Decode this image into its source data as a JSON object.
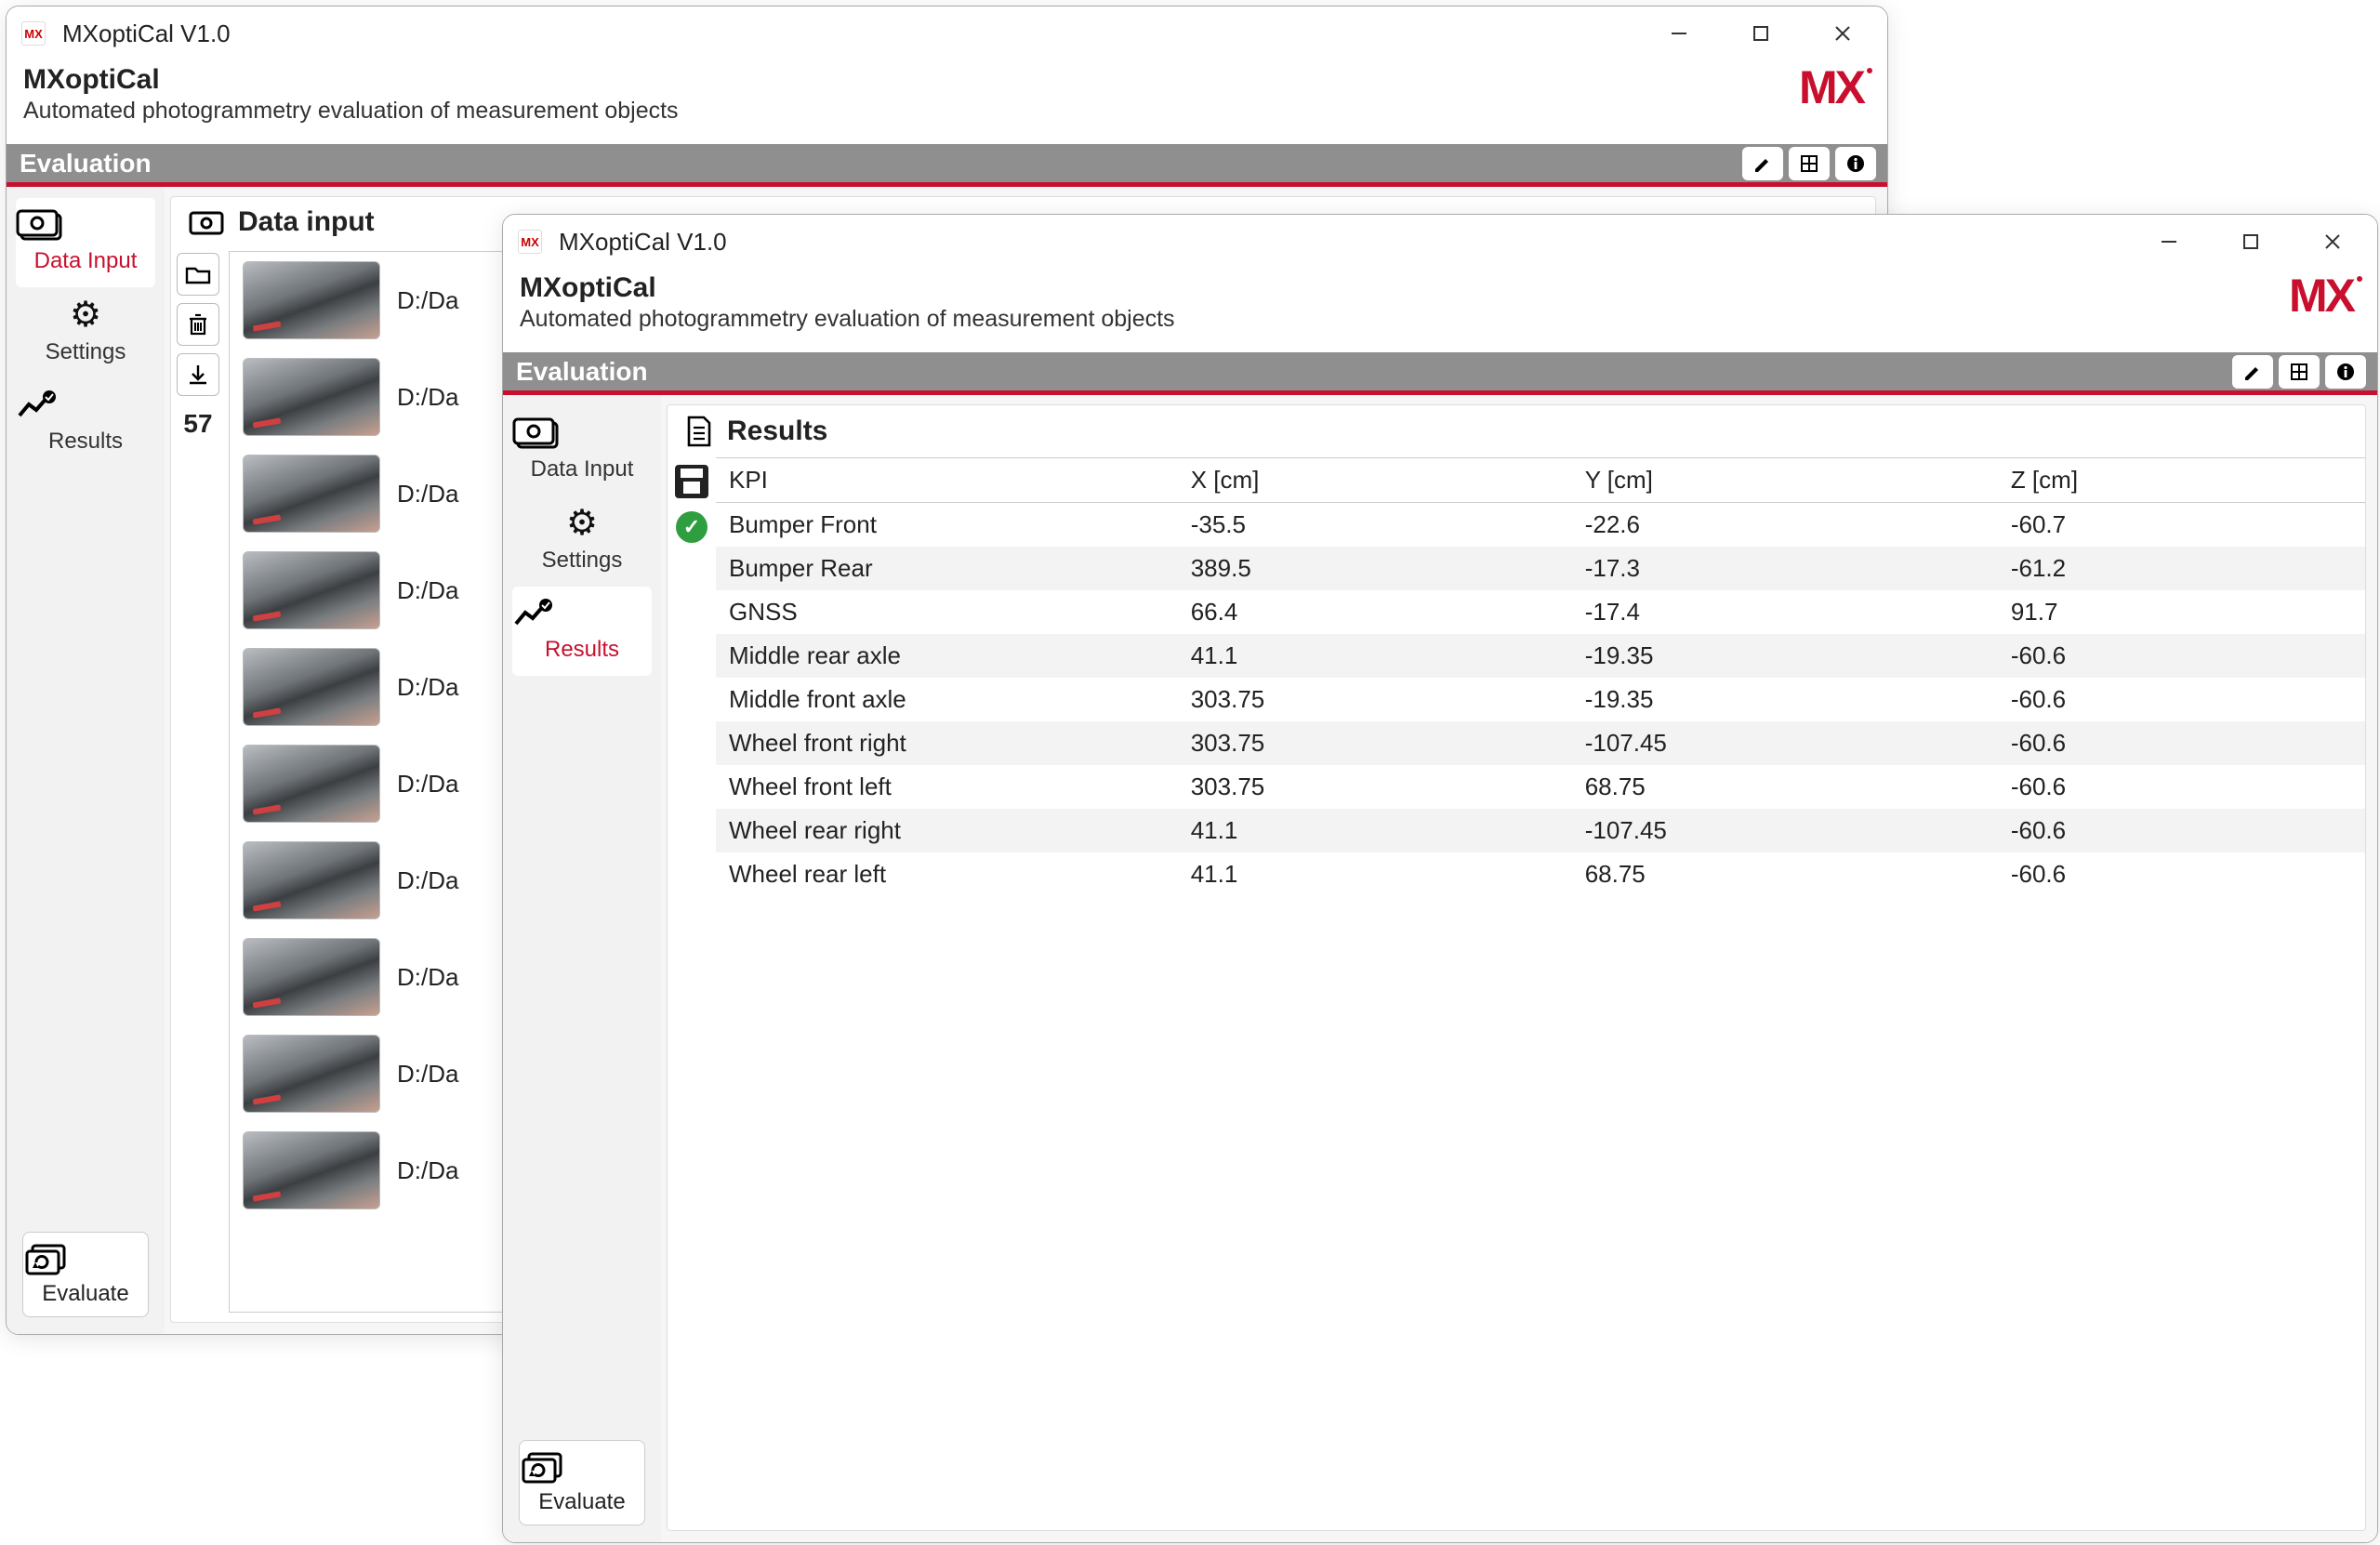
{
  "win1": {
    "title": "MXoptiCal V1.0",
    "app_name": "MXoptiCal",
    "tagline": "Automated photogrammetry evaluation of measurement objects",
    "section": "Evaluation",
    "logo": "MX",
    "nav": {
      "data_input": "Data Input",
      "settings": "Settings",
      "results": "Results",
      "evaluate": "Evaluate"
    },
    "panel_title": "Data input",
    "count": "57",
    "rows": [
      {
        "path": "D:/Da"
      },
      {
        "path": "D:/Da"
      },
      {
        "path": "D:/Da"
      },
      {
        "path": "D:/Da"
      },
      {
        "path": "D:/Da"
      },
      {
        "path": "D:/Da"
      },
      {
        "path": "D:/Da"
      },
      {
        "path": "D:/Da"
      },
      {
        "path": "D:/Da"
      },
      {
        "path": "D:/Da"
      }
    ]
  },
  "win2": {
    "title": "MXoptiCal V1.0",
    "app_name": "MXoptiCal",
    "tagline": "Automated photogrammetry evaluation of measurement objects",
    "section": "Evaluation",
    "logo": "MX",
    "nav": {
      "data_input": "Data Input",
      "settings": "Settings",
      "results": "Results",
      "evaluate": "Evaluate"
    },
    "panel_title": "Results",
    "headers": {
      "kpi": "KPI",
      "x": "X [cm]",
      "y": "Y [cm]",
      "z": "Z [cm]"
    },
    "rows": [
      {
        "kpi": "Bumper Front",
        "x": "-35.5",
        "y": "-22.6",
        "z": "-60.7"
      },
      {
        "kpi": "Bumper Rear",
        "x": "389.5",
        "y": "-17.3",
        "z": "-61.2"
      },
      {
        "kpi": "GNSS",
        "x": "66.4",
        "y": "-17.4",
        "z": "91.7"
      },
      {
        "kpi": "Middle rear axle",
        "x": "41.1",
        "y": "-19.35",
        "z": "-60.6"
      },
      {
        "kpi": "Middle front axle",
        "x": "303.75",
        "y": "-19.35",
        "z": "-60.6"
      },
      {
        "kpi": "Wheel front right",
        "x": "303.75",
        "y": "-107.45",
        "z": "-60.6"
      },
      {
        "kpi": "Wheel front left",
        "x": "303.75",
        "y": "68.75",
        "z": "-60.6"
      },
      {
        "kpi": "Wheel rear right",
        "x": "41.1",
        "y": "-107.45",
        "z": "-60.6"
      },
      {
        "kpi": "Wheel rear left",
        "x": "41.1",
        "y": "68.75",
        "z": "-60.6"
      }
    ]
  },
  "chart_data": {
    "type": "table",
    "title": "Results",
    "columns": [
      "KPI",
      "X [cm]",
      "Y [cm]",
      "Z [cm]"
    ],
    "rows": [
      [
        "Bumper Front",
        -35.5,
        -22.6,
        -60.7
      ],
      [
        "Bumper Rear",
        389.5,
        -17.3,
        -61.2
      ],
      [
        "GNSS",
        66.4,
        -17.4,
        91.7
      ],
      [
        "Middle rear axle",
        41.1,
        -19.35,
        -60.6
      ],
      [
        "Middle front axle",
        303.75,
        -19.35,
        -60.6
      ],
      [
        "Wheel front right",
        303.75,
        -107.45,
        -60.6
      ],
      [
        "Wheel front left",
        303.75,
        68.75,
        -60.6
      ],
      [
        "Wheel rear right",
        41.1,
        -107.45,
        -60.6
      ],
      [
        "Wheel rear left",
        41.1,
        68.75,
        -60.6
      ]
    ]
  }
}
